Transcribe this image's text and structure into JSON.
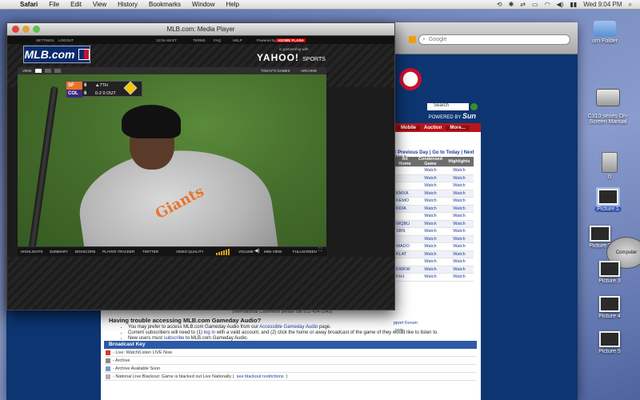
{
  "menubar": {
    "app": "Safari",
    "items": [
      "File",
      "Edit",
      "View",
      "History",
      "Bookmarks",
      "Window",
      "Help"
    ],
    "clock": "Wed 9:04 PM"
  },
  "desktop": {
    "folder_label": "urn Folder",
    "printer_label": "C310 series On-\nScreen Manual",
    "drive_label": "0",
    "pictures": [
      "Picture 1",
      "Picture 2",
      "Picture 3",
      "Picture 4",
      "Picture 5"
    ],
    "computer_tip": "Computer"
  },
  "safari": {
    "search_placeholder": "Google"
  },
  "site": {
    "search_label": "Search",
    "powered_by": "POWERED BY",
    "sponsor": "Sun",
    "nav": [
      "Mobile",
      "Auction",
      "More..."
    ],
    "day_nav": "< Previous Day | Go to Today | Next Day >",
    "table_headers": [
      "Alt Home",
      "Condensed Game",
      "Highlights"
    ],
    "rows": [
      {
        "call": "",
        "condensed": "Watch",
        "highlights": "Watch"
      },
      {
        "call": "",
        "condensed": "Watch",
        "highlights": "Watch"
      },
      {
        "call": "",
        "condensed": "Watch",
        "highlights": "Watch"
      },
      {
        "call": "KMXA",
        "condensed": "Watch",
        "highlights": "Watch"
      },
      {
        "call": "KEMO",
        "condensed": "Watch",
        "highlights": "Watch"
      },
      {
        "call": "KDIA",
        "condensed": "Watch",
        "highlights": "Watch"
      },
      {
        "call": "",
        "condensed": "Watch",
        "highlights": "Watch"
      },
      {
        "call": "WQBU",
        "condensed": "Watch",
        "highlights": "Watch"
      },
      {
        "call": "SBN",
        "condensed": "Watch",
        "highlights": "Watch"
      },
      {
        "call": "",
        "condensed": "Watch",
        "highlights": "Watch"
      },
      {
        "call": "WADO",
        "condensed": "Watch",
        "highlights": "Watch"
      },
      {
        "call": "KLAT",
        "condensed": "Watch",
        "highlights": "Watch"
      },
      {
        "call": "",
        "condensed": "Watch",
        "highlights": "Watch"
      },
      {
        "call": "KWKW",
        "condensed": "Watch",
        "highlights": "Watch"
      },
      {
        "call": "KHJ",
        "condensed": "Watch",
        "highlights": "Watch"
      }
    ],
    "forum_link": "pport Forum",
    "com_link": ".com",
    "intl_note": "(International Customers please call 512-434-1542)",
    "trouble_title": "Having trouble accessing MLB.com Gameday Audio?",
    "trouble_items": [
      {
        "pre": "You may prefer to access MLB.com Gameday Audio from our ",
        "link": "Accessible Gameday Audio",
        "post": " page."
      },
      {
        "pre": "Current subscribers will need to (1) ",
        "link": "log in",
        "post": " with a valid account, and (2) click the home or away broadcast of the game of they would like to listen to."
      },
      {
        "pre": "New users must ",
        "link": "subscribe",
        "post": " to MLB.com Gameday Audio."
      }
    ],
    "broadcast_key_title": "Broadcast Key",
    "key_rows": [
      {
        "text": "- Live: Watch/Listen LIVE Now",
        "link": "",
        "color": "#d23a2a"
      },
      {
        "text": "- Archive",
        "link": "",
        "color": "#8a8a8a"
      },
      {
        "text": "- Archive Available Soon",
        "link": "",
        "color": "#7a9acb"
      },
      {
        "text": "- National Live Blackout: Game is blacked out Live Nationally (",
        "link": "see blackout restrictions",
        "post": ")",
        "color": "#b0b0b0"
      }
    ]
  },
  "player": {
    "title": "MLB.com: Media Player",
    "top_links": [
      "SETTINGS",
      "LOGOUT"
    ],
    "time": "12:04 AM ET",
    "top_right": [
      "TERMS",
      "FAQ",
      "HELP"
    ],
    "powered_by": "Powered by",
    "flash": "ADOBE FLASH",
    "logo": "MLB.com",
    "partner_text": "in partnership with",
    "yahoo": "YAHOO!",
    "yahoo_sub": "SPORTS",
    "view_label": "VIEW",
    "todays_games": "TODAY'S GAMES",
    "archive": "ARCHIVE",
    "scorebug": {
      "away_team": "SF",
      "away_score": "6",
      "home_team": "COL",
      "home_score": "6",
      "inning": "▲7TH",
      "count": "0-2",
      "outs": "0 OUT",
      "away_color": "#e8742a",
      "home_color": "#3d2a7a"
    },
    "jersey": "Giants",
    "controls": [
      "HIGHLIGHTS",
      "SUMMARY",
      "BOXSCORE",
      "PLAYER TRACKER",
      "TWITTER"
    ],
    "video_quality": "VIDEO QUALITY",
    "volume": "VOLUME",
    "mini_view": "MINI VIEW",
    "fullscreen": "FULLSCREEN"
  }
}
